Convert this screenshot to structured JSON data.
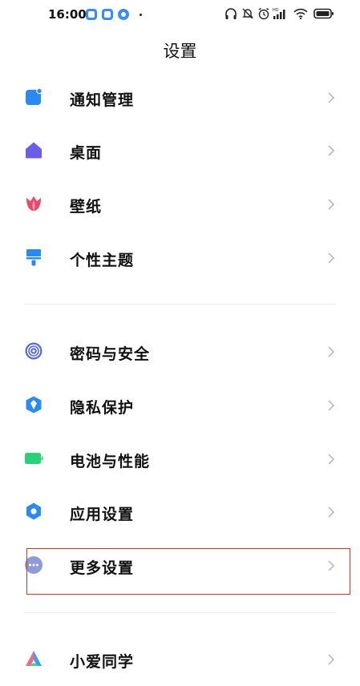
{
  "status_bar": {
    "time": "16:00",
    "icons": [
      "app-icon",
      "app-icon",
      "c-app-icon",
      "headphones-icon",
      "mute-icon",
      "alarm-icon",
      "hd-signal-icon",
      "wifi-icon",
      "battery-icon"
    ]
  },
  "header": {
    "title": "设置"
  },
  "groups": [
    {
      "items": [
        {
          "label": "通知管理",
          "icon": "notification-icon",
          "color": "#2a8af0"
        },
        {
          "label": "桌面",
          "icon": "home-icon",
          "color": "#6a5de8"
        },
        {
          "label": "壁纸",
          "icon": "tulip-icon",
          "color": "#e84a6a"
        },
        {
          "label": "个性主题",
          "icon": "brush-icon",
          "color": "#2a8af0"
        }
      ]
    },
    {
      "items": [
        {
          "label": "密码与安全",
          "icon": "fingerprint-icon",
          "color": "#5b6ad8"
        },
        {
          "label": "隐私保护",
          "icon": "privacy-shield-icon",
          "color": "#2a8af0"
        },
        {
          "label": "电池与性能",
          "icon": "battery-icon",
          "color": "#2bd07a"
        },
        {
          "label": "应用设置",
          "icon": "gear-icon",
          "color": "#2a8af0"
        },
        {
          "label": "更多设置",
          "icon": "more-icon",
          "color": "#8f9bd6"
        }
      ]
    },
    {
      "items": [
        {
          "label": "小爱同学",
          "icon": "xiaoai-icon",
          "color": "#3aa0f0"
        }
      ]
    }
  ],
  "highlight_color": "#c0392b"
}
